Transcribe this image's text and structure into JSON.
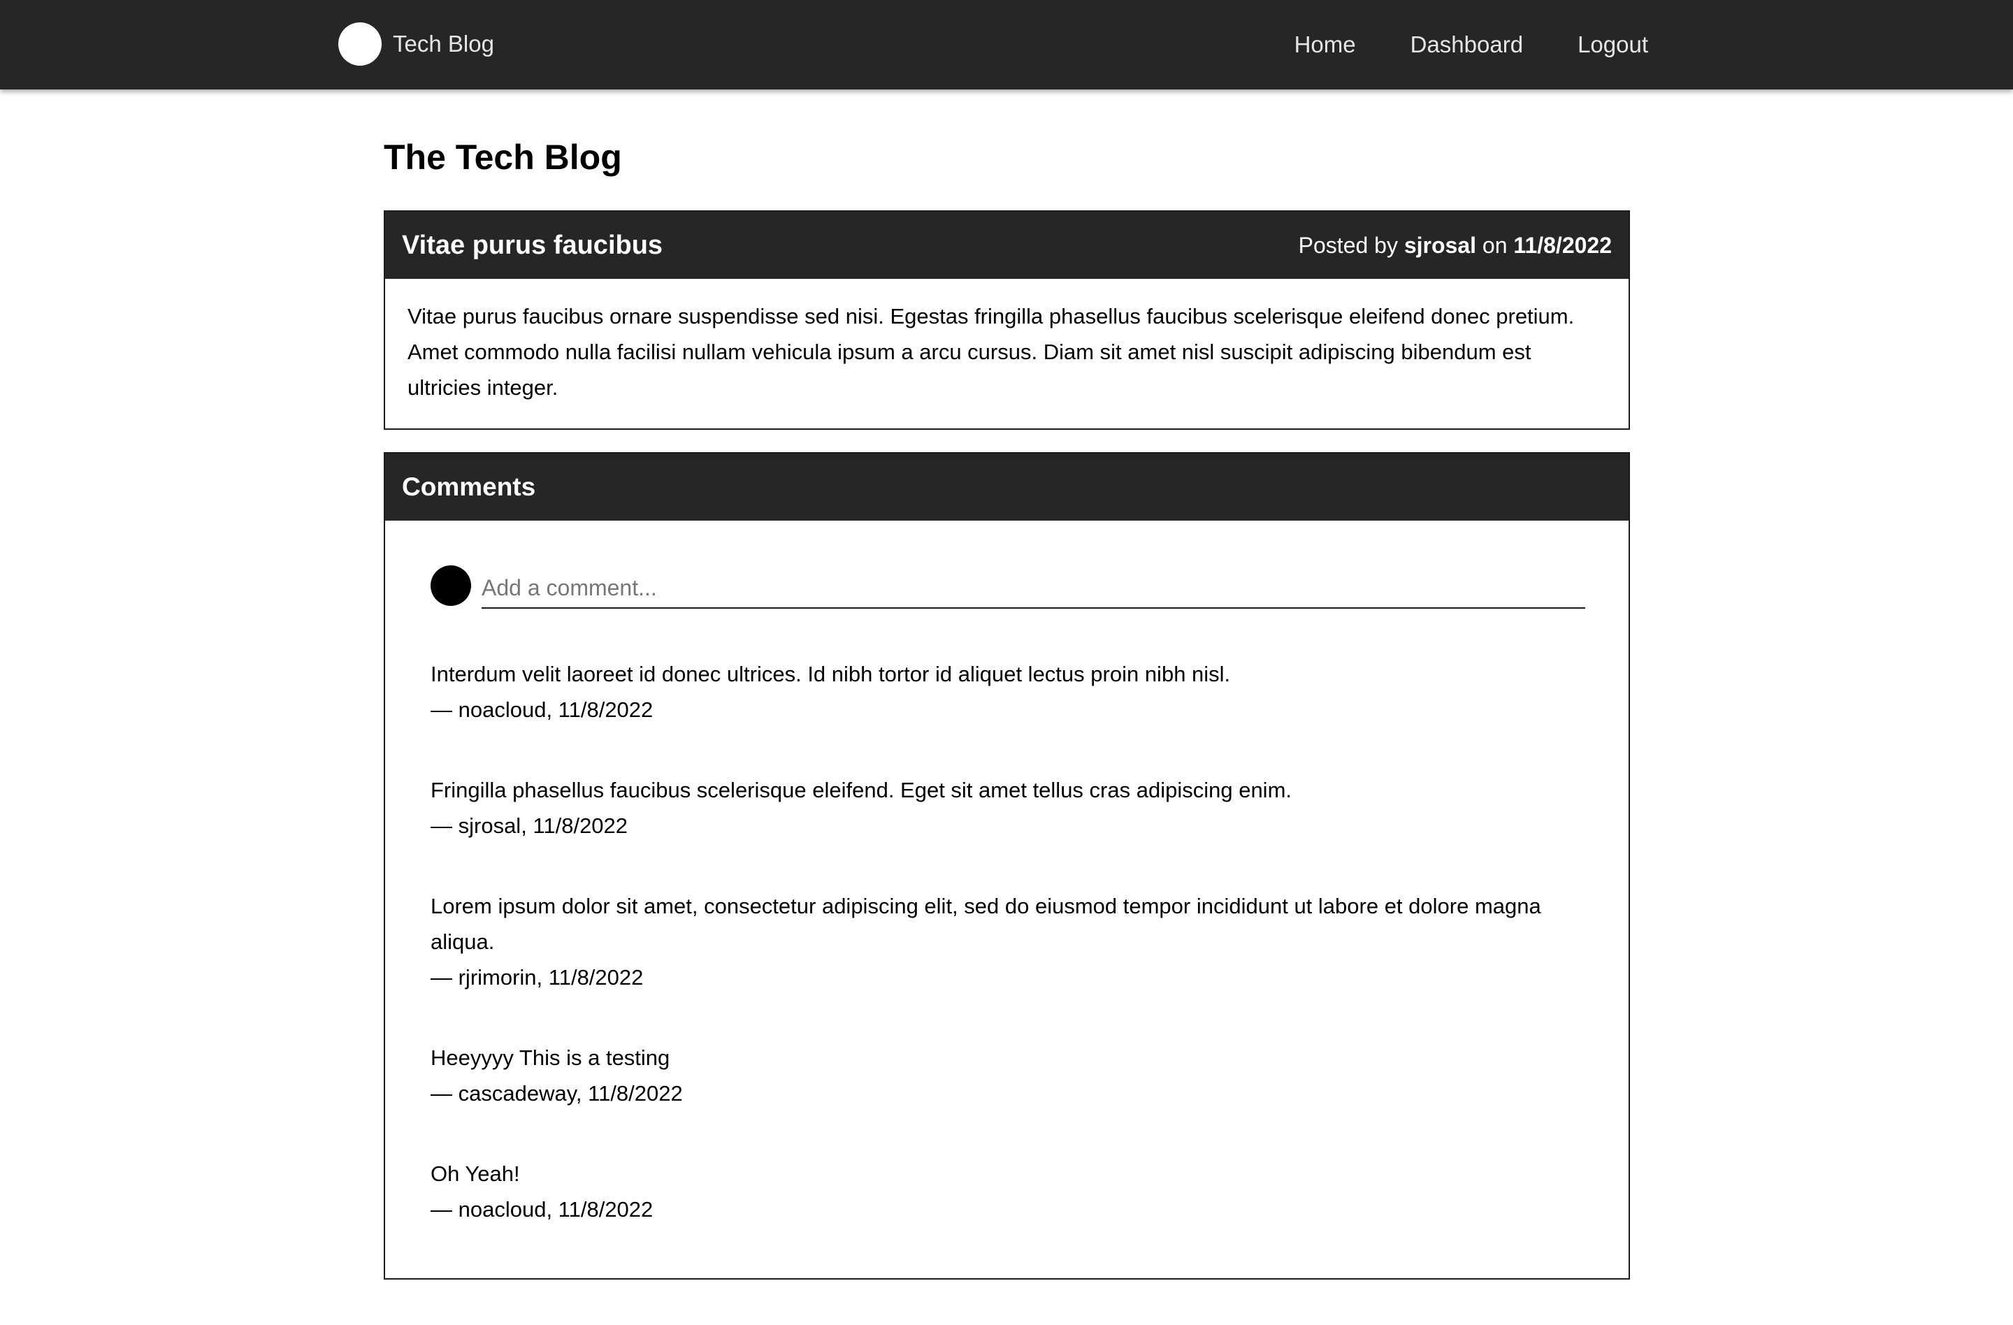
{
  "nav": {
    "brand": "Tech Blog",
    "links": [
      "Home",
      "Dashboard",
      "Logout"
    ]
  },
  "page": {
    "title": "The Tech Blog"
  },
  "post": {
    "title": "Vitae purus faucibus",
    "posted_by_prefix": "Posted by",
    "author": "sjrosal",
    "on_word": "on",
    "date": "11/8/2022",
    "body": "Vitae purus faucibus ornare suspendisse sed nisi. Egestas fringilla phasellus faucibus scelerisque eleifend donec pretium. Amet commodo nulla facilisi nullam vehicula ipsum a arcu cursus. Diam sit amet nisl suscipit adipiscing bibendum est ultricies integer."
  },
  "comments": {
    "title": "Comments",
    "input_placeholder": "Add a comment...",
    "items": [
      {
        "text": "Interdum velit laoreet id donec ultrices. Id nibh tortor id aliquet lectus proin nibh nisl.",
        "byline": "— noacloud, 11/8/2022"
      },
      {
        "text": "Fringilla phasellus faucibus scelerisque eleifend. Eget sit amet tellus cras adipiscing enim.",
        "byline": "— sjrosal, 11/8/2022"
      },
      {
        "text": "Lorem ipsum dolor sit amet, consectetur adipiscing elit, sed do eiusmod tempor incididunt ut labore et dolore magna aliqua.",
        "byline": "— rjrimorin, 11/8/2022"
      },
      {
        "text": "Heeyyyy This is a testing",
        "byline": "— cascadeway, 11/8/2022"
      },
      {
        "text": "Oh Yeah!",
        "byline": "— noacloud, 11/8/2022"
      }
    ]
  },
  "colors": {
    "navbar_bg": "#262626",
    "header_bg": "#262626",
    "nav_text": "#e6e6e6"
  }
}
